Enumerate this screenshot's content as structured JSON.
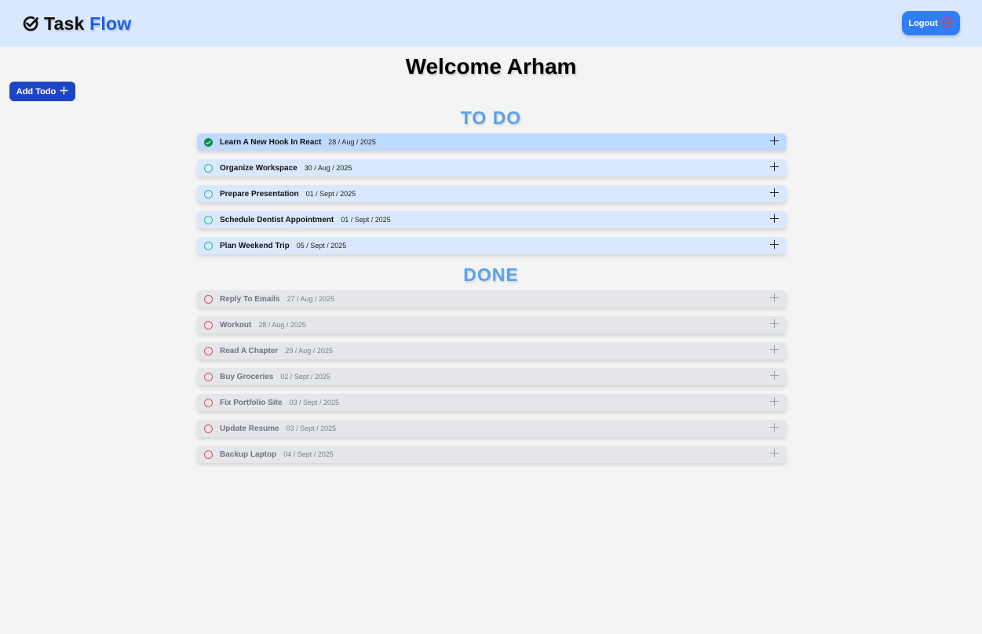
{
  "header": {
    "brand_part1": "Task",
    "brand_part2": "Flow",
    "logout_label": "Logout",
    "brand_icon": "check-circle-icon",
    "logout_icon": "logout-icon",
    "colors": {
      "bar": "#d9e8fd",
      "brand_accent": "#1f5fe0",
      "logout_button": "#2f7ef5"
    }
  },
  "welcome": "Welcome Arham",
  "add_todo": {
    "label": "Add Todo",
    "icon": "plus-icon",
    "color": "#1e44c7"
  },
  "todo": {
    "title": "TO DO",
    "items": [
      {
        "title": "Learn A New Hook In React",
        "date": "28 / Aug / 2025",
        "checked": true
      },
      {
        "title": "Organize Workspace",
        "date": "30 / Aug / 2025",
        "checked": false
      },
      {
        "title": "Prepare Presentation",
        "date": "01 / Sept / 2025",
        "checked": false
      },
      {
        "title": "Schedule Dentist Appointment",
        "date": "01 / Sept / 2025",
        "checked": false
      },
      {
        "title": "Plan Weekend Trip",
        "date": "05 / Sept / 2025",
        "checked": false
      }
    ]
  },
  "done": {
    "title": "DONE",
    "items": [
      {
        "title": "Reply To Emails",
        "date": "27 / Aug / 2025"
      },
      {
        "title": "Workout",
        "date": "28 / Aug / 2025"
      },
      {
        "title": "Read A Chapter",
        "date": "29 / Aug / 2025"
      },
      {
        "title": "Buy Groceries",
        "date": "02 / Sept / 2025"
      },
      {
        "title": "Fix Portfolio Site",
        "date": "03 / Sept / 2025"
      },
      {
        "title": "Update Resume",
        "date": "03 / Sept / 2025"
      },
      {
        "title": "Backup Laptop",
        "date": "04 / Sept / 2025"
      }
    ]
  }
}
